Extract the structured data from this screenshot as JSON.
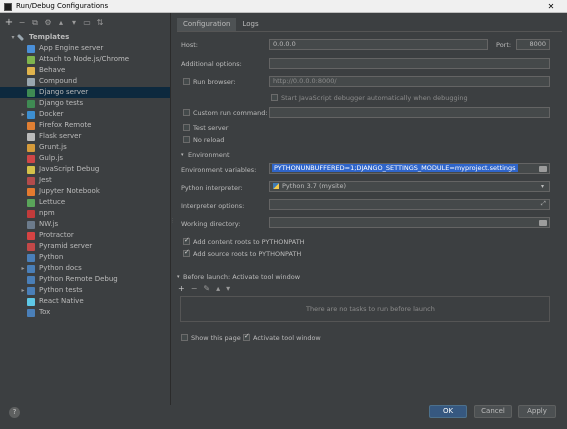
{
  "window": {
    "title": "Run/Debug Configurations",
    "close_glyph": "✕"
  },
  "left_toolbar": {
    "buttons": [
      "+",
      "−",
      "⧉",
      "⚙",
      "▴",
      "▾",
      "▭",
      "⇅"
    ]
  },
  "tree": {
    "root": {
      "label": "Templates",
      "arrow": "▾"
    },
    "items": [
      {
        "label": "App Engine server",
        "color": "#4a8fd8",
        "arrow": ""
      },
      {
        "label": "Attach to Node.js/Chrome",
        "color": "#7fb54e",
        "arrow": ""
      },
      {
        "label": "Behave",
        "color": "#e0b34c",
        "arrow": ""
      },
      {
        "label": "Compound",
        "color": "#9aa7b0",
        "arrow": ""
      },
      {
        "label": "Django server",
        "color": "#3f8a53",
        "arrow": "",
        "selected": true
      },
      {
        "label": "Django tests",
        "color": "#3f8a53",
        "arrow": ""
      },
      {
        "label": "Docker",
        "color": "#3d8fd1",
        "arrow": "▸"
      },
      {
        "label": "Firefox Remote",
        "color": "#e07f33",
        "arrow": ""
      },
      {
        "label": "Flask server",
        "color": "#bbbbbb",
        "arrow": ""
      },
      {
        "label": "Grunt.js",
        "color": "#d69b3a",
        "arrow": ""
      },
      {
        "label": "Gulp.js",
        "color": "#cf4647",
        "arrow": ""
      },
      {
        "label": "JavaScript Debug",
        "color": "#d4c24a",
        "arrow": ""
      },
      {
        "label": "Jest",
        "color": "#b34b4b",
        "arrow": ""
      },
      {
        "label": "Jupyter Notebook",
        "color": "#e57a2f",
        "arrow": ""
      },
      {
        "label": "Lettuce",
        "color": "#5aa55a",
        "arrow": ""
      },
      {
        "label": "npm",
        "color": "#c23b3b",
        "arrow": ""
      },
      {
        "label": "NW.js",
        "color": "#6c7b8c",
        "arrow": ""
      },
      {
        "label": "Protractor",
        "color": "#d64343",
        "arrow": ""
      },
      {
        "label": "Pyramid server",
        "color": "#c24848",
        "arrow": ""
      },
      {
        "label": "Python",
        "color": "#4a7fb8",
        "arrow": ""
      },
      {
        "label": "Python docs",
        "color": "#4a7fb8",
        "arrow": "▸"
      },
      {
        "label": "Python Remote Debug",
        "color": "#4a7fb8",
        "arrow": ""
      },
      {
        "label": "Python tests",
        "color": "#4a7fb8",
        "arrow": "▸"
      },
      {
        "label": "React Native",
        "color": "#5ec8e6",
        "arrow": ""
      },
      {
        "label": "Tox",
        "color": "#4a7fb8",
        "arrow": ""
      }
    ]
  },
  "tabs": [
    {
      "label": "Configuration",
      "active": true
    },
    {
      "label": "Logs",
      "active": false
    }
  ],
  "form": {
    "host_label": "Host:",
    "host_value": "0.0.0.0",
    "port_label": "Port:",
    "port_value": "8000",
    "additional_options_label": "Additional options:",
    "additional_options_value": "",
    "run_browser_label": "Run browser:",
    "run_browser_value": "http://0.0.0.0:8000/",
    "js_debugger_label": "Start JavaScript debugger automatically when debugging",
    "custom_run_command_label": "Custom run command:",
    "custom_run_command_value": "",
    "test_server_label": "Test server",
    "no_reload_label": "No reload",
    "environment_section_label": "Environment",
    "env_vars_label": "Environment variables:",
    "env_vars_value": "PYTHONUNBUFFERED=1;DJANGO_SETTINGS_MODULE=myproject.settings",
    "python_interpreter_label": "Python interpreter:",
    "python_interpreter_value": "Python 3.7 (mysite)",
    "interpreter_options_label": "Interpreter options:",
    "interpreter_options_value": "",
    "working_directory_label": "Working directory:",
    "working_directory_value": "",
    "add_content_roots_label": "Add content roots to PYTHONPATH",
    "add_source_roots_label": "Add source roots to PYTHONPATH",
    "before_launch_label": "Before launch: Activate tool window",
    "before_launch_empty": "There are no tasks to run before launch",
    "show_this_page_label": "Show this page",
    "activate_tool_window_label": "Activate tool window",
    "section_arrow": "▾",
    "combo_arrow": "▾",
    "expand_glyph": "⤢"
  },
  "before_launch_toolbar": [
    "+",
    "−",
    "✎",
    "▴",
    "▾"
  ],
  "buttons": {
    "help": "?",
    "ok": "OK",
    "cancel": "Cancel",
    "apply": "Apply"
  }
}
